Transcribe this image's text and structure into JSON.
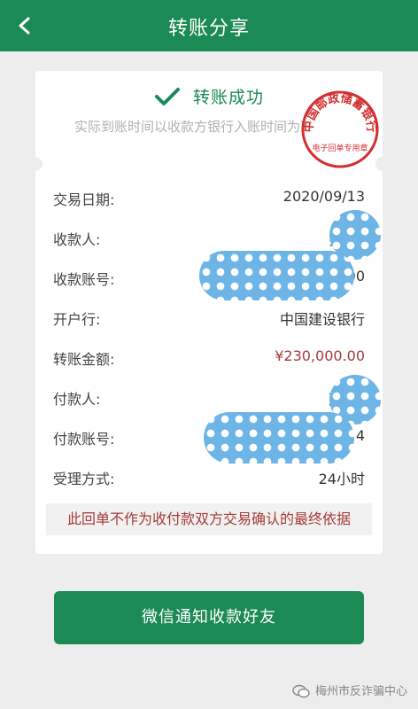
{
  "header": {
    "title": "转账分享",
    "back_icon": "chevron-left-icon"
  },
  "status": {
    "title": "转账成功",
    "subtitle": "实际到账时间以收款方银行入账时间为准",
    "check_icon": "checkmark-icon",
    "check_color": "#1b8a55"
  },
  "stamp": {
    "text_top": "中国邮政储蓄银行",
    "text_bottom": "电子回单专用章",
    "color": "#d23030"
  },
  "details": [
    {
      "label": "交易日期:",
      "value": "2020/09/13"
    },
    {
      "label": "收款人:",
      "value": "罗"
    },
    {
      "label": "收款账号:",
      "value": "62    00"
    },
    {
      "label": "开户行:",
      "value": "中国建设银行"
    },
    {
      "label": "转账金额:",
      "value": "¥230,000.00"
    },
    {
      "label": "付款人:",
      "value": "万"
    },
    {
      "label": "付款账号:",
      "value": "62    4"
    },
    {
      "label": "受理方式:",
      "value": "24小时"
    }
  ],
  "notice": "此回单不作为收付款双方交易确认的最终依据",
  "button": {
    "label": "微信通知收款好友"
  },
  "watermark": {
    "text": "梅州市反诈骗中心",
    "icon": "wechat-icon"
  },
  "colors": {
    "brand": "#1b8a55",
    "amount": "#a73a3a",
    "background": "#ededed",
    "blur": "#6db5e6"
  }
}
